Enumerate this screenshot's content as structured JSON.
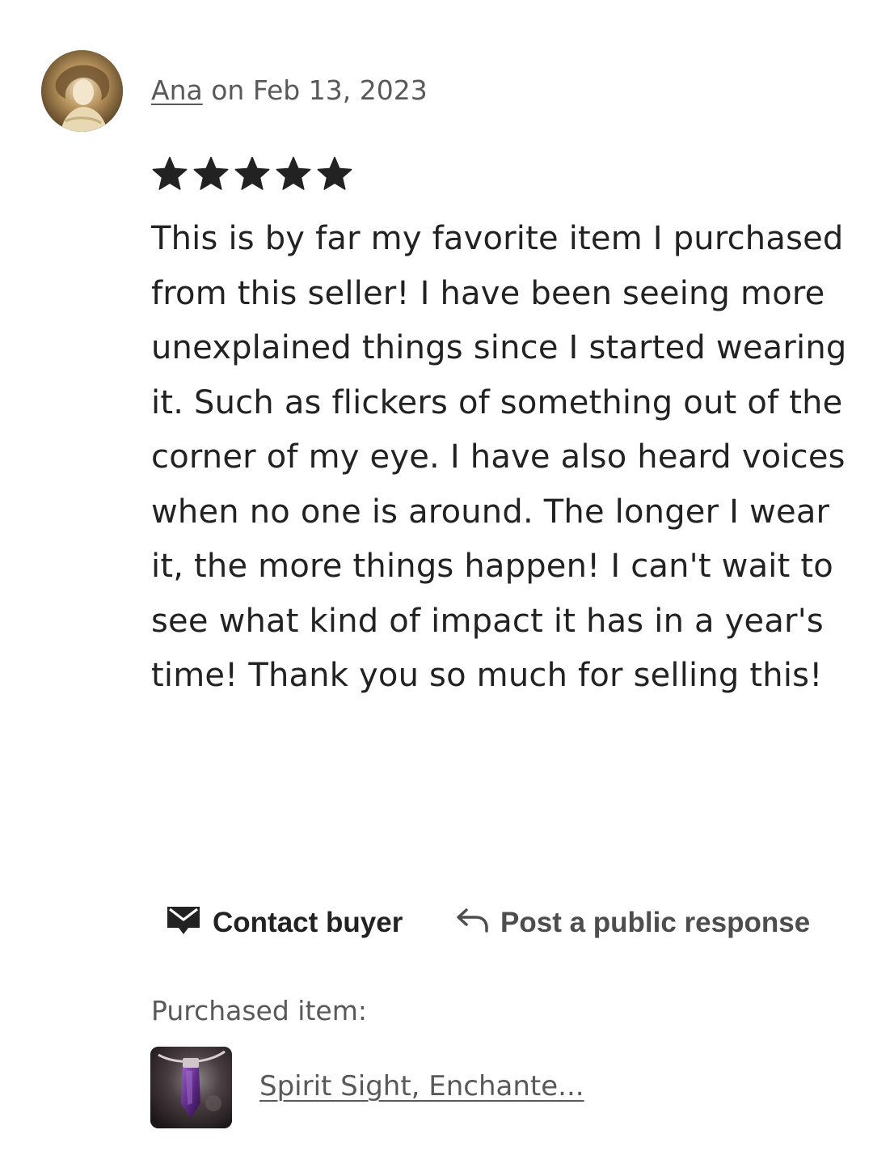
{
  "review": {
    "reviewer_name": "Ana",
    "date_text": "on Feb 13, 2023",
    "rating": 5,
    "rating_max": 5,
    "text": "This is by far my favorite item I purchased from this seller! I have been seeing more unexplained things since I started wearing it. Such as flickers of something out of the corner of my eye. I have also heard voices when no one is around. The longer I wear it, the more things happen! I can't wait to see what kind of impact it has in a year's time! Thank you so much for selling this!"
  },
  "actions": {
    "contact_label": "Contact buyer",
    "contact_icon": "envelope-icon",
    "respond_label": "Post a public response",
    "respond_icon": "reply-arrow-icon"
  },
  "purchase": {
    "label": "Purchased item:",
    "item_title": "Spirit Sight, Enchante..."
  },
  "colors": {
    "text": "#222222",
    "muted": "#595959",
    "star": "#222222"
  }
}
